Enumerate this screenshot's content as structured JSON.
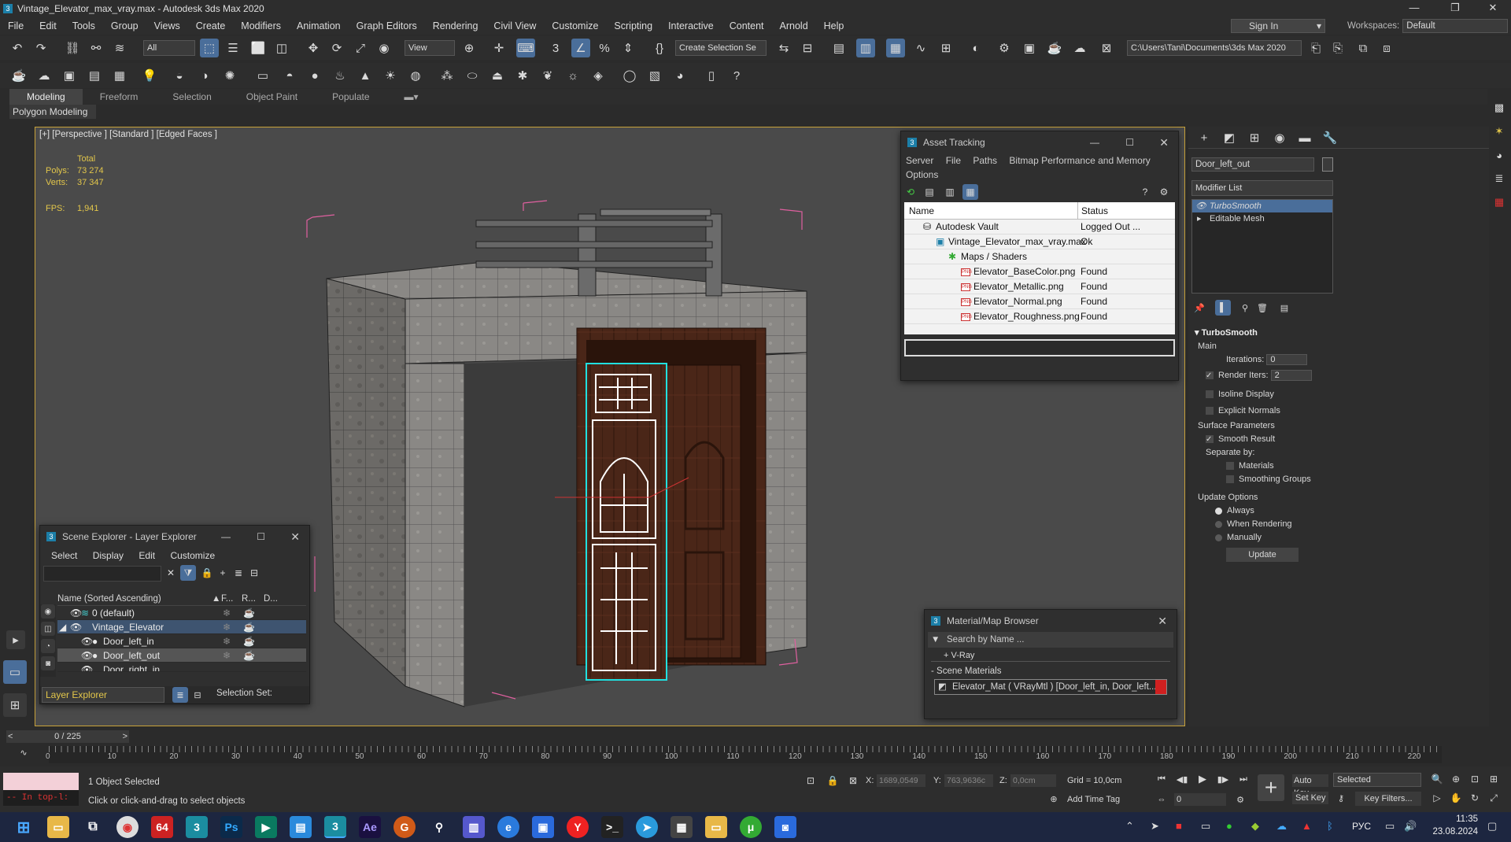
{
  "window": {
    "title": "Vintage_Elevator_max_vray.max - Autodesk 3ds Max 2020"
  },
  "menu": [
    "File",
    "Edit",
    "Tools",
    "Group",
    "Views",
    "Create",
    "Modifiers",
    "Animation",
    "Graph Editors",
    "Rendering",
    "Civil View",
    "Customize",
    "Scripting",
    "Interactive",
    "Content",
    "Arnold",
    "Help"
  ],
  "account": {
    "sign_in": "Sign In",
    "workspaces_label": "Workspaces:",
    "workspace": "Default"
  },
  "toolbar": {
    "filter": "All",
    "ref_coord": "View",
    "selection_set": "Create Selection Se",
    "project_path": "C:\\Users\\Tani\\Documents\\3ds Max 2020"
  },
  "ribbon": {
    "tabs": [
      "Modeling",
      "Freeform",
      "Selection",
      "Object Paint",
      "Populate"
    ],
    "sub": "Polygon Modeling"
  },
  "viewport": {
    "label": "[+] [Perspective ] [Standard ] [Edged Faces ]",
    "stats": {
      "total": "Total",
      "polys_label": "Polys:",
      "polys": "73 274",
      "verts_label": "Verts:",
      "verts": "37 347",
      "fps_label": "FPS:",
      "fps": "1,941"
    }
  },
  "asset_tracking": {
    "title": "Asset Tracking",
    "menu": [
      "Server",
      "File",
      "Paths",
      "Bitmap Performance and Memory"
    ],
    "menu2": "Options",
    "col_name": "Name",
    "col_status": "Status",
    "rows": [
      {
        "name": "Autodesk Vault",
        "status": "Logged Out ..."
      },
      {
        "name": "Vintage_Elevator_max_vray.max",
        "status": "Ok"
      },
      {
        "name": "Maps / Shaders",
        "status": ""
      },
      {
        "name": "Elevator_BaseColor.png",
        "status": "Found"
      },
      {
        "name": "Elevator_Metallic.png",
        "status": "Found"
      },
      {
        "name": "Elevator_Normal.png",
        "status": "Found"
      },
      {
        "name": "Elevator_Roughness.png",
        "status": "Found"
      }
    ]
  },
  "scene_explorer": {
    "title": "Scene Explorer - Layer Explorer",
    "menu": [
      "Select",
      "Display",
      "Edit",
      "Customize"
    ],
    "col_name": "Name (Sorted Ascending)",
    "col_f": "F...",
    "col_r": "R...",
    "col_d": "D...",
    "rows": [
      "0 (default)",
      "Vintage_Elevator",
      "Door_left_in",
      "Door_left_out",
      "Door_right_in"
    ],
    "footer_dropdown": "Layer Explorer",
    "selection_set": "Selection Set:"
  },
  "material_browser": {
    "title": "Material/Map Browser",
    "search": "Search by Name ...",
    "vray": "+ V-Ray",
    "scene_materials": "- Scene Materials",
    "material": "Elevator_Mat  ( VRayMtl ) [Door_left_in, Door_left..."
  },
  "command_panel": {
    "object_name": "Door_left_out",
    "modifier_list": "Modifier List",
    "stack": [
      "TurboSmooth",
      "Editable Mesh"
    ],
    "rollout": "TurboSmooth",
    "main": "Main",
    "iterations_label": "Iterations:",
    "iterations": "0",
    "render_iters_label": "Render Iters:",
    "render_iters": "2",
    "isoline": "Isoline Display",
    "explicit": "Explicit Normals",
    "surface": "Surface Parameters",
    "smooth": "Smooth Result",
    "separate": "Separate by:",
    "materials": "Materials",
    "smoothing_groups": "Smoothing Groups",
    "update_options": "Update Options",
    "always": "Always",
    "when_rendering": "When Rendering",
    "manually": "Manually",
    "update": "Update"
  },
  "timeline": {
    "frame": "0 / 225",
    "ticks": [
      "0",
      "10",
      "20",
      "30",
      "40",
      "50",
      "60",
      "70",
      "80",
      "90",
      "100",
      "110",
      "120",
      "130",
      "140",
      "150",
      "160",
      "170",
      "180",
      "190",
      "200",
      "210",
      "220"
    ]
  },
  "status": {
    "maxscript": "-- In top-l:",
    "selected": "1 Object Selected",
    "prompt": "Click or click-and-drag to select objects",
    "x_label": "X:",
    "x": "1689,0549",
    "y_label": "Y:",
    "y": "763,9636c",
    "z_label": "Z:",
    "z": "0,0cm",
    "grid": "Grid = 10,0cm",
    "add_time_tag": "Add Time Tag",
    "auto_key": "Auto Key",
    "set_key": "Set Key",
    "key_mode": "Selected",
    "key_filters": "Key Filters...",
    "frame_field": "0"
  },
  "taskbar": {
    "lang": "РУС",
    "time": "11:35",
    "date": "23.08.2024"
  }
}
